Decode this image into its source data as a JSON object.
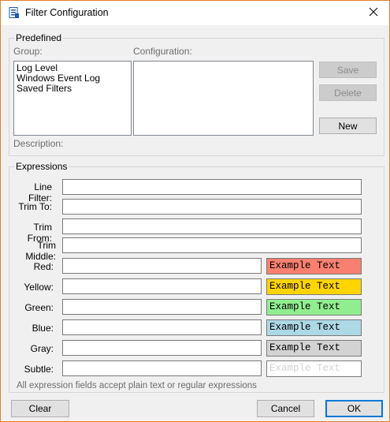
{
  "window": {
    "title": "Filter Configuration",
    "accent_border": "#e08030"
  },
  "predefined": {
    "legend": "Predefined",
    "group_label": "Group:",
    "configuration_label": "Configuration:",
    "groups": [
      "Log Level",
      "Windows Event Log",
      "Saved Filters"
    ],
    "configurations": [],
    "save_label": "Save",
    "delete_label": "Delete",
    "new_label": "New",
    "description_label": "Description:"
  },
  "expressions": {
    "legend": "Expressions",
    "line_filter_label": "Line Filter:",
    "trim_to_label": "Trim To:",
    "trim_from_label": "Trim From:",
    "trim_middle_label": "Trim Middle:",
    "colors": [
      {
        "key": "red",
        "label": "Red:",
        "example": "Example Text",
        "bg": "#f98070",
        "fg": "#000000"
      },
      {
        "key": "yellow",
        "label": "Yellow:",
        "example": "Example Text",
        "bg": "#ffd400",
        "fg": "#000000"
      },
      {
        "key": "green",
        "label": "Green:",
        "example": "Example Text",
        "bg": "#90ee90",
        "fg": "#000000"
      },
      {
        "key": "blue",
        "label": "Blue:",
        "example": "Example Text",
        "bg": "#add8e6",
        "fg": "#000000"
      },
      {
        "key": "gray",
        "label": "Gray:",
        "example": "Example Text",
        "bg": "#d3d3d3",
        "fg": "#000000"
      },
      {
        "key": "subtle",
        "label": "Subtle:",
        "example": "Example Text",
        "bg": "#ffffff",
        "fg": "#d3d3d3"
      }
    ],
    "hint": "All expression fields accept plain text or regular expressions"
  },
  "footer": {
    "clear_label": "Clear",
    "cancel_label": "Cancel",
    "ok_label": "OK"
  },
  "icons": {
    "app": "app-doc-icon",
    "close": "close-icon"
  }
}
